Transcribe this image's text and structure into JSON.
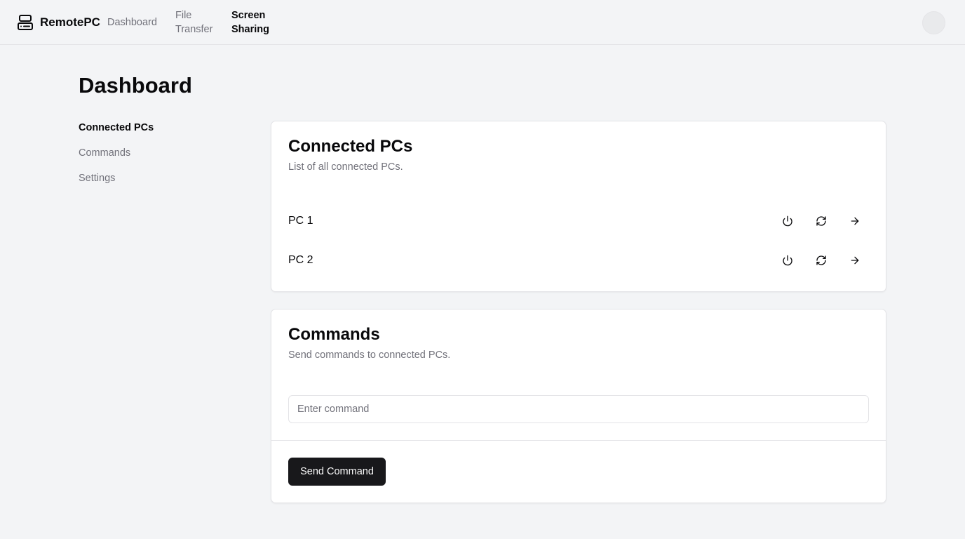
{
  "header": {
    "brand": "RemotePC",
    "brand_icon": "server-icon",
    "nav": [
      {
        "label": "Dashboard",
        "active": false
      },
      {
        "label": "File Transfer",
        "active": false
      },
      {
        "label": "Screen Sharing",
        "active": true
      }
    ],
    "avatar_icon": "user-avatar"
  },
  "page": {
    "title": "Dashboard"
  },
  "sidebar": {
    "items": [
      {
        "label": "Connected PCs",
        "active": true
      },
      {
        "label": "Commands",
        "active": false
      },
      {
        "label": "Settings",
        "active": false
      }
    ]
  },
  "connected_pcs": {
    "title": "Connected PCs",
    "description": "List of all connected PCs.",
    "pcs": [
      {
        "name": "PC 1",
        "actions": [
          "power-icon",
          "refresh-icon",
          "arrow-right-icon"
        ]
      },
      {
        "name": "PC 2",
        "actions": [
          "power-icon",
          "refresh-icon",
          "arrow-right-icon"
        ]
      }
    ]
  },
  "commands": {
    "title": "Commands",
    "description": "Send commands to connected PCs.",
    "input_value": "",
    "input_placeholder": "Enter command",
    "send_label": "Send Command"
  },
  "colors": {
    "background": "#f3f4f6",
    "card": "#ffffff",
    "border": "#e4e4e7",
    "text": "#09090b",
    "muted_text": "#71717a",
    "primary_button": "#18181b"
  }
}
